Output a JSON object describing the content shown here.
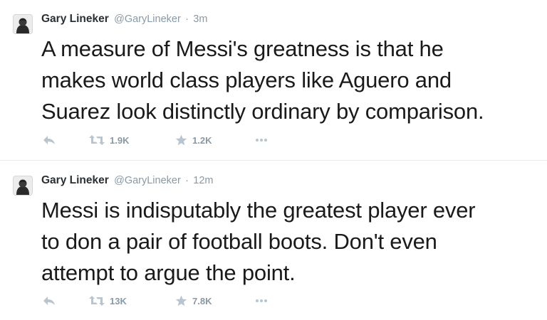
{
  "tweets": [
    {
      "author": {
        "name": "Gary Lineker",
        "handle": "@GaryLineker"
      },
      "separator": "·",
      "time": "3m",
      "text": "A measure of Messi's greatness is that he\nmakes world class players like Aguero and\nSuarez look distinctly ordinary by comparison.",
      "retweets": "1.9K",
      "favorites": "1.2K"
    },
    {
      "author": {
        "name": "Gary Lineker",
        "handle": "@GaryLineker"
      },
      "separator": "·",
      "time": "12m",
      "text": "Messi is indisputably the greatest player ever\nto don a pair of football boots. Don't even\nattempt to argue the point.",
      "retweets": "13K",
      "favorites": "7.8K"
    }
  ],
  "icons": {
    "reply": "reply-icon",
    "retweet": "retweet-icon",
    "favorite": "star-icon",
    "more": "more-dots-icon"
  },
  "colors": {
    "text": "#1a1a1a",
    "name": "#292f33",
    "muted": "#8899a6",
    "icon": "#b8c5ce",
    "divider": "#e6ecf0"
  }
}
